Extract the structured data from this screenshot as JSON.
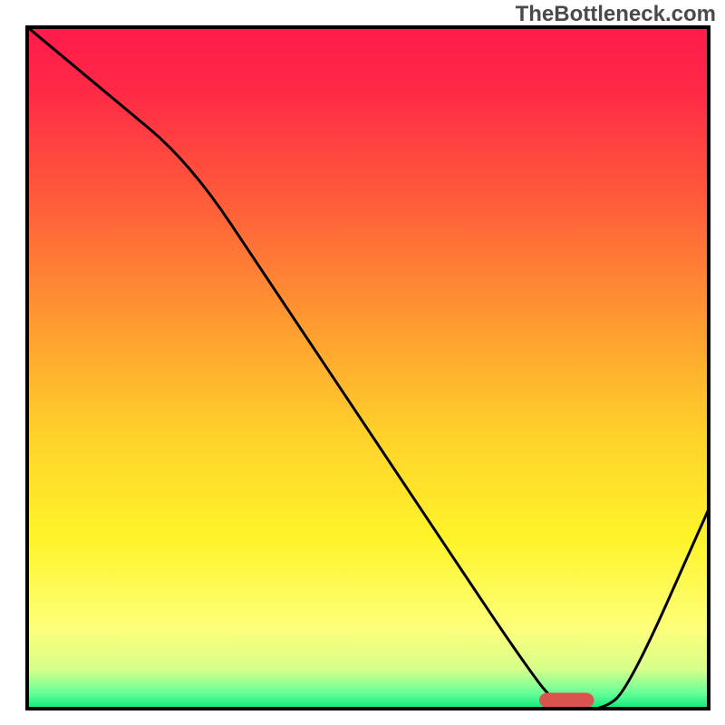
{
  "watermark": "TheBottleneck.com",
  "chart_data": {
    "type": "line",
    "title": "",
    "xlabel": "",
    "ylabel": "",
    "xlim": [
      0,
      100
    ],
    "ylim": [
      0,
      100
    ],
    "gradient_stops": [
      {
        "offset": 0,
        "color": "#ff1a4b"
      },
      {
        "offset": 0.1,
        "color": "#ff2a46"
      },
      {
        "offset": 0.25,
        "color": "#ff5a3a"
      },
      {
        "offset": 0.45,
        "color": "#ffa030"
      },
      {
        "offset": 0.6,
        "color": "#ffd22a"
      },
      {
        "offset": 0.75,
        "color": "#fff42a"
      },
      {
        "offset": 0.88,
        "color": "#feff7a"
      },
      {
        "offset": 0.94,
        "color": "#d6ff8a"
      },
      {
        "offset": 0.975,
        "color": "#66ff99"
      },
      {
        "offset": 1.0,
        "color": "#00e676"
      }
    ],
    "curve": {
      "x": [
        0,
        12,
        24,
        36,
        48,
        60,
        72,
        78,
        84,
        88,
        100
      ],
      "y": [
        100,
        90,
        80,
        62,
        44,
        26,
        8,
        0,
        0,
        3,
        30
      ]
    },
    "marker": {
      "shape": "rounded-bar",
      "x_start": 75,
      "x_end": 83,
      "y": 1.5,
      "color": "#d9544f",
      "corner_radius_pct": 1.2,
      "height_pct": 2.2
    }
  }
}
